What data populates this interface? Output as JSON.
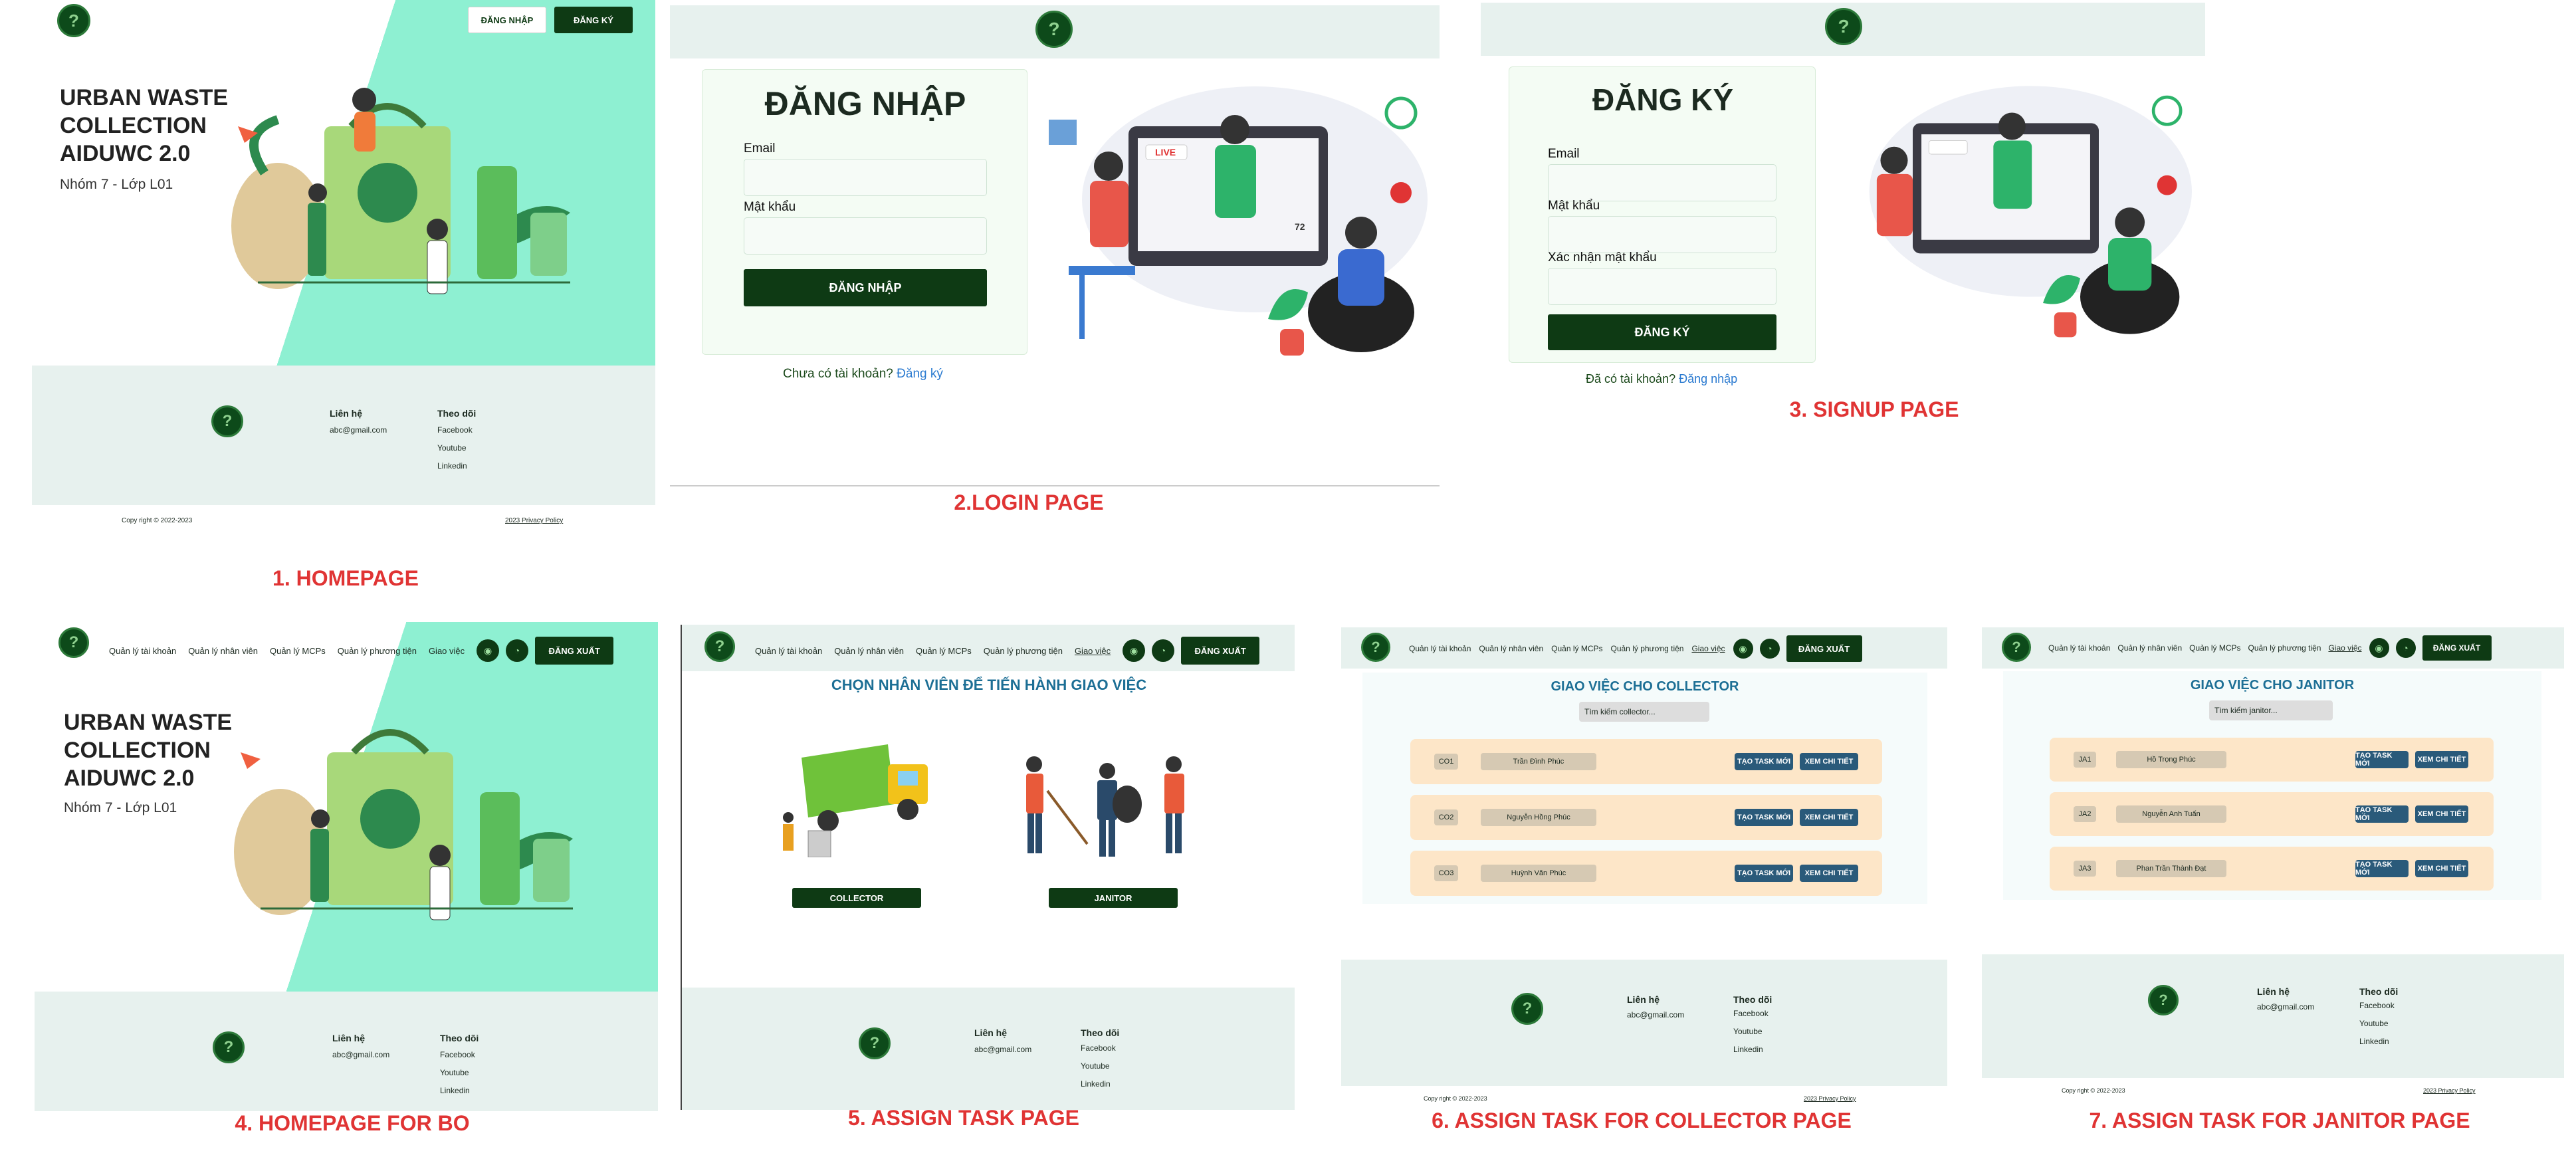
{
  "colors": {
    "accent": "#0e3a14",
    "mint": "#8ef0d2",
    "footer": "#e7f1ee",
    "caption": "#e03434",
    "row": "#fde6c8",
    "rowbtn": "#2a5a7a",
    "heading": "#1d6f95"
  },
  "common": {
    "logo_glyph": "?",
    "brand": "URBAN WASTE COLLECTION AIDUWC 2.0",
    "brand_lines": [
      "URBAN WASTE",
      "COLLECTION",
      "AIDUWC 2.0"
    ],
    "group": "Nhóm 7 - Lớp L01",
    "footer": {
      "contact_h": "Liên hệ",
      "contact_email": "abc@gmail.com",
      "follow_h": "Theo dõi",
      "links": [
        "Facebook",
        "Youtube",
        "Linkedin"
      ],
      "copyright": "Copy right © 2022-2023",
      "policy": "2023 Privacy Policy"
    },
    "nav": [
      "Quản lý tài khoản",
      "Quản lý nhân viên",
      "Quản lý MCPs",
      "Quản lý phương tiện",
      "Giao việc"
    ],
    "logout": "ĐĂNG XUẤT",
    "login_btn": "ĐĂNG NHẬP",
    "signup_btn": "ĐĂNG KÝ"
  },
  "login": {
    "title": "ĐĂNG NHẬP",
    "email": "Email",
    "password": "Mật khẩu",
    "submit": "ĐĂNG NHẬP",
    "prompt": "Chưa có tài khoản?",
    "link": "Đăng ký"
  },
  "signup": {
    "title": "ĐĂNG KÝ",
    "email": "Email",
    "password": "Mật khẩu",
    "confirm": "Xác nhận mật khẩu",
    "submit": "ĐĂNG KÝ",
    "prompt": "Đã có tài khoản?",
    "link": "Đăng nhập"
  },
  "assign": {
    "heading": "CHỌN NHÂN VIÊN ĐỂ TIẾN HÀNH GIAO VIỆC",
    "collector": "COLLECTOR",
    "janitor": "JANITOR"
  },
  "collector_page": {
    "heading": "GIAO VIỆC CHO COLLECTOR",
    "search": "Tìm kiếm collector...",
    "new_task": "TẠO TASK MỚI",
    "view": "XEM CHI TIẾT",
    "rows": [
      {
        "id": "CO1",
        "name": "Trần Đình Phúc"
      },
      {
        "id": "CO2",
        "name": "Nguyễn Hồng Phúc"
      },
      {
        "id": "CO3",
        "name": "Huỳnh Văn Phúc"
      }
    ]
  },
  "janitor_page": {
    "heading": "GIAO VIỆC CHO JANITOR",
    "search": "Tìm kiếm janitor...",
    "new_task": "TẠO TASK MỚI",
    "view": "XEM CHI TIẾT",
    "rows": [
      {
        "id": "JA1",
        "name": "Hồ Trọng Phúc"
      },
      {
        "id": "JA2",
        "name": "Nguyễn Anh Tuấn"
      },
      {
        "id": "JA3",
        "name": "Phan Trần Thành Đạt"
      }
    ]
  },
  "captions": {
    "p1": "1. HOMEPAGE",
    "p2": "2.LOGIN PAGE",
    "p3": "3. SIGNUP PAGE",
    "p4": "4. HOMEPAGE FOR BO",
    "p5": "5. ASSIGN TASK PAGE",
    "p6": "6. ASSIGN TASK FOR COLLECTOR PAGE",
    "p7": "7. ASSIGN TASK FOR JANITOR PAGE"
  },
  "illustration": {
    "live": "LIVE",
    "count": "72"
  }
}
